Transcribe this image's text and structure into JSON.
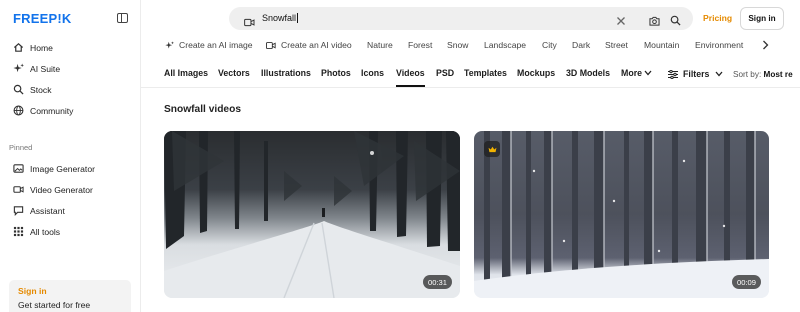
{
  "brand": {
    "logo_text": "FREEP!K"
  },
  "sidebar": {
    "nav": [
      {
        "label": "Home",
        "icon": "home-icon"
      },
      {
        "label": "AI Suite",
        "icon": "sparkle-icon"
      },
      {
        "label": "Stock",
        "icon": "search-icon"
      },
      {
        "label": "Community",
        "icon": "globe-icon"
      }
    ],
    "pinned_label": "Pinned",
    "pinned": [
      {
        "label": "Image Generator",
        "icon": "image-icon"
      },
      {
        "label": "Video Generator",
        "icon": "video-icon"
      },
      {
        "label": "Assistant",
        "icon": "chat-icon"
      },
      {
        "label": "All tools",
        "icon": "grid-icon"
      }
    ],
    "signin_card": {
      "title": "Sign in",
      "subtitle": "Get started for free"
    }
  },
  "header": {
    "search": {
      "value": "Snowfall"
    },
    "pricing": "Pricing",
    "signin": "Sign in"
  },
  "chips": [
    "Create an AI image",
    "Create an AI video",
    "Nature",
    "Forest",
    "Snow",
    "Landscape",
    "City",
    "Dark",
    "Street",
    "Mountain",
    "Environment"
  ],
  "tabs": [
    "All Images",
    "Vectors",
    "Illustrations",
    "Photos",
    "Icons",
    "Videos",
    "PSD",
    "Templates",
    "Mockups",
    "3D Models",
    "More"
  ],
  "active_tab": "Videos",
  "filters_label": "Filters",
  "sort": {
    "label": "Sort by:",
    "value": "Most re"
  },
  "section_title": "Snowfall videos",
  "videos": [
    {
      "duration": "00:31",
      "premium": false
    },
    {
      "duration": "00:09",
      "premium": true
    }
  ],
  "colors": {
    "brand_blue": "#1273eb",
    "accent_orange": "#e58a00"
  }
}
